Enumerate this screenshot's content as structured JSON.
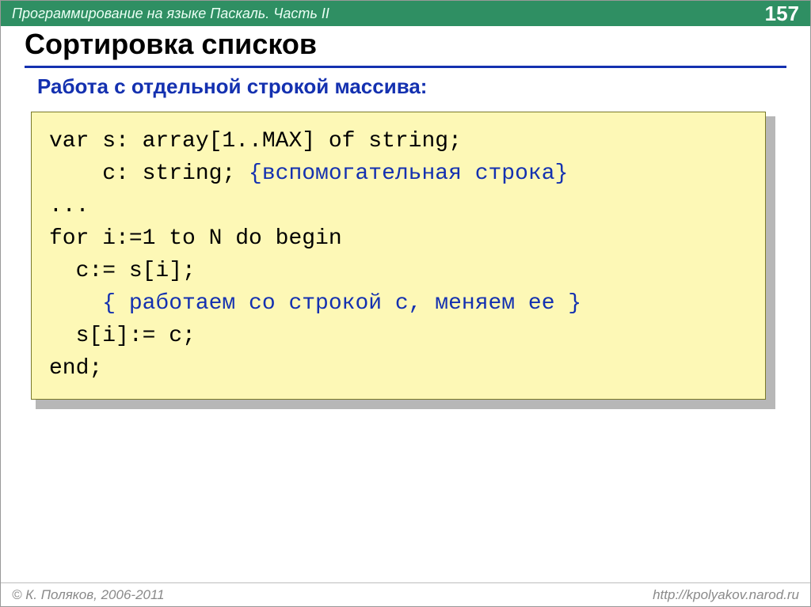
{
  "header": {
    "course": "Программирование на языке Паскаль. Часть II",
    "page": "157"
  },
  "title": "Сортировка списков",
  "subtitle": "Работа с отдельной строкой массива:",
  "code": {
    "l1": "var s: array[1..MAX] of string;",
    "l2a": "    c: string; ",
    "l2b": "{вспомогательная строка}",
    "l3": "...",
    "l4": "for i:=1 to N do begin",
    "l5": "  c:= s[i];",
    "l6": "    { работаем со строкой c, меняем ее }",
    "l7": "  s[i]:= c;",
    "l8": "end;"
  },
  "footer": {
    "copyright": "© К. Поляков, 2006-2011",
    "url": "http://kpolyakov.narod.ru"
  }
}
